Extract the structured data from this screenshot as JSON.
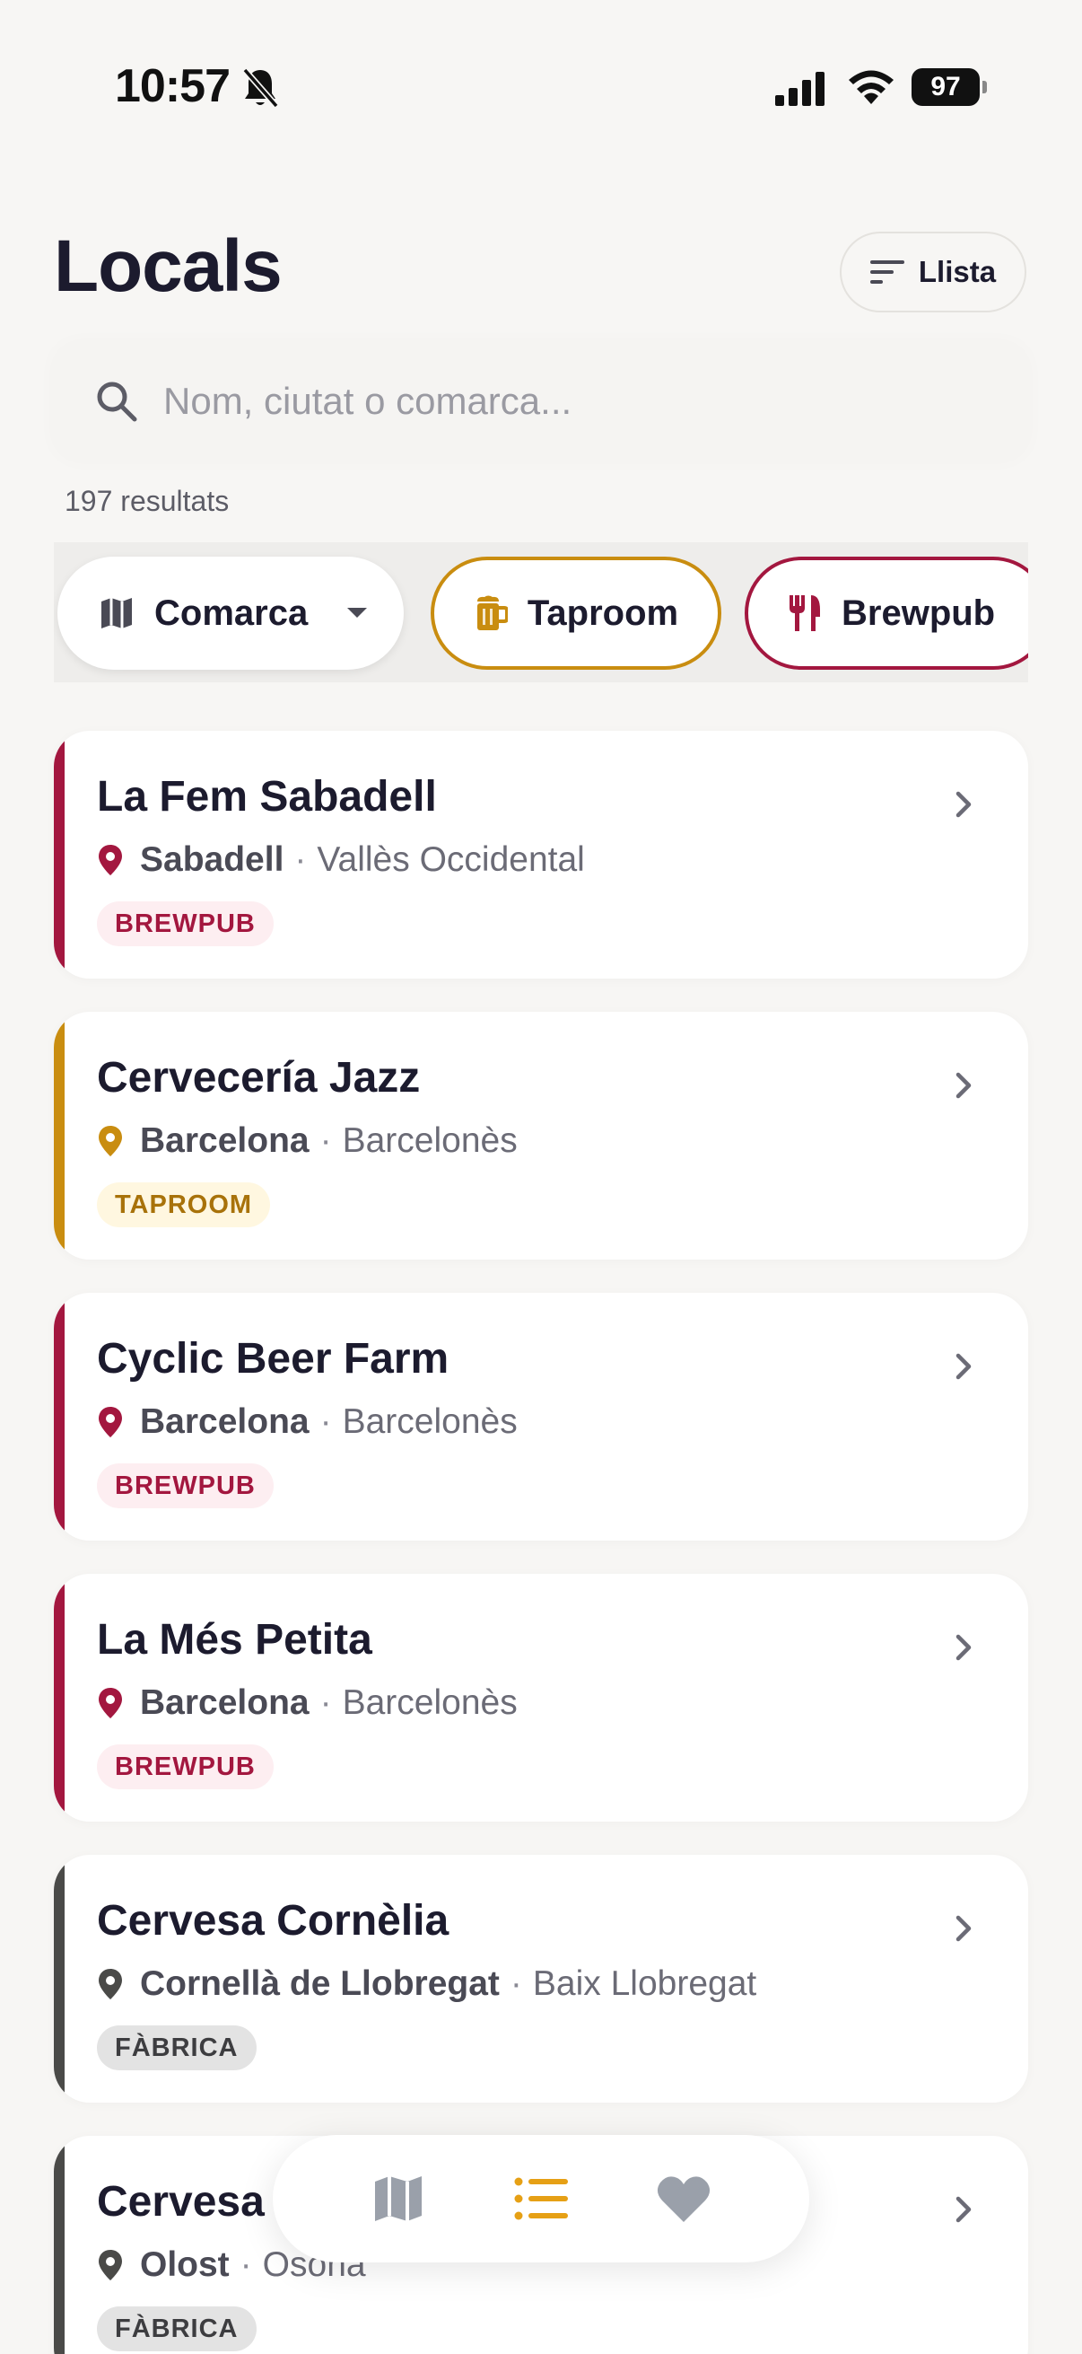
{
  "status_bar": {
    "time": "10:57",
    "battery": "97"
  },
  "header": {
    "title": "Locals",
    "view_toggle_label": "Llista"
  },
  "search": {
    "placeholder": "Nom, ciutat o comarca...",
    "value": ""
  },
  "results": {
    "count_label": "197 resultats"
  },
  "filters": [
    {
      "label": "Comarca",
      "icon": "map-icon",
      "type": "dropdown"
    },
    {
      "label": "Taproom",
      "icon": "beer-mug-icon",
      "color": "#c98d10"
    },
    {
      "label": "Brewpub",
      "icon": "fork-knife-icon",
      "color": "#a3173f"
    }
  ],
  "venues": [
    {
      "name": "La Fem Sabadell",
      "city": "Sabadell",
      "region": "Vallès Occidental",
      "badge": "BREWPUB",
      "type": "brewpub",
      "color": "#a3173f"
    },
    {
      "name": "Cervecería Jazz",
      "city": "Barcelona",
      "region": "Barcelonès",
      "badge": "TAPROOM",
      "type": "taproom",
      "color": "#c98d10"
    },
    {
      "name": "Cyclic Beer Farm",
      "city": "Barcelona",
      "region": "Barcelonès",
      "badge": "BREWPUB",
      "type": "brewpub",
      "color": "#a3173f"
    },
    {
      "name": "La Més Petita",
      "city": "Barcelona",
      "region": "Barcelonès",
      "badge": "BREWPUB",
      "type": "brewpub",
      "color": "#a3173f"
    },
    {
      "name": "Cervesa Cornèlia",
      "city": "Cornellà de Llobregat",
      "region": "Baix Llobregat",
      "badge": "FÀBRICA",
      "type": "fabrica",
      "color": "#4a4a48"
    },
    {
      "name": "Cervesa",
      "city": "Olost",
      "region": "Osona",
      "badge": "FÀBRICA",
      "type": "fabrica",
      "color": "#4a4a48"
    }
  ],
  "bottom_nav": [
    {
      "icon": "map-icon",
      "active": false
    },
    {
      "icon": "list-icon",
      "active": true
    },
    {
      "icon": "heart-icon",
      "active": false
    }
  ],
  "colors": {
    "brewpub": "#a3173f",
    "taproom": "#c98d10",
    "fabrica": "#4a4a48",
    "nav_active": "#e6a015",
    "nav_inactive": "#9aa0aa"
  }
}
